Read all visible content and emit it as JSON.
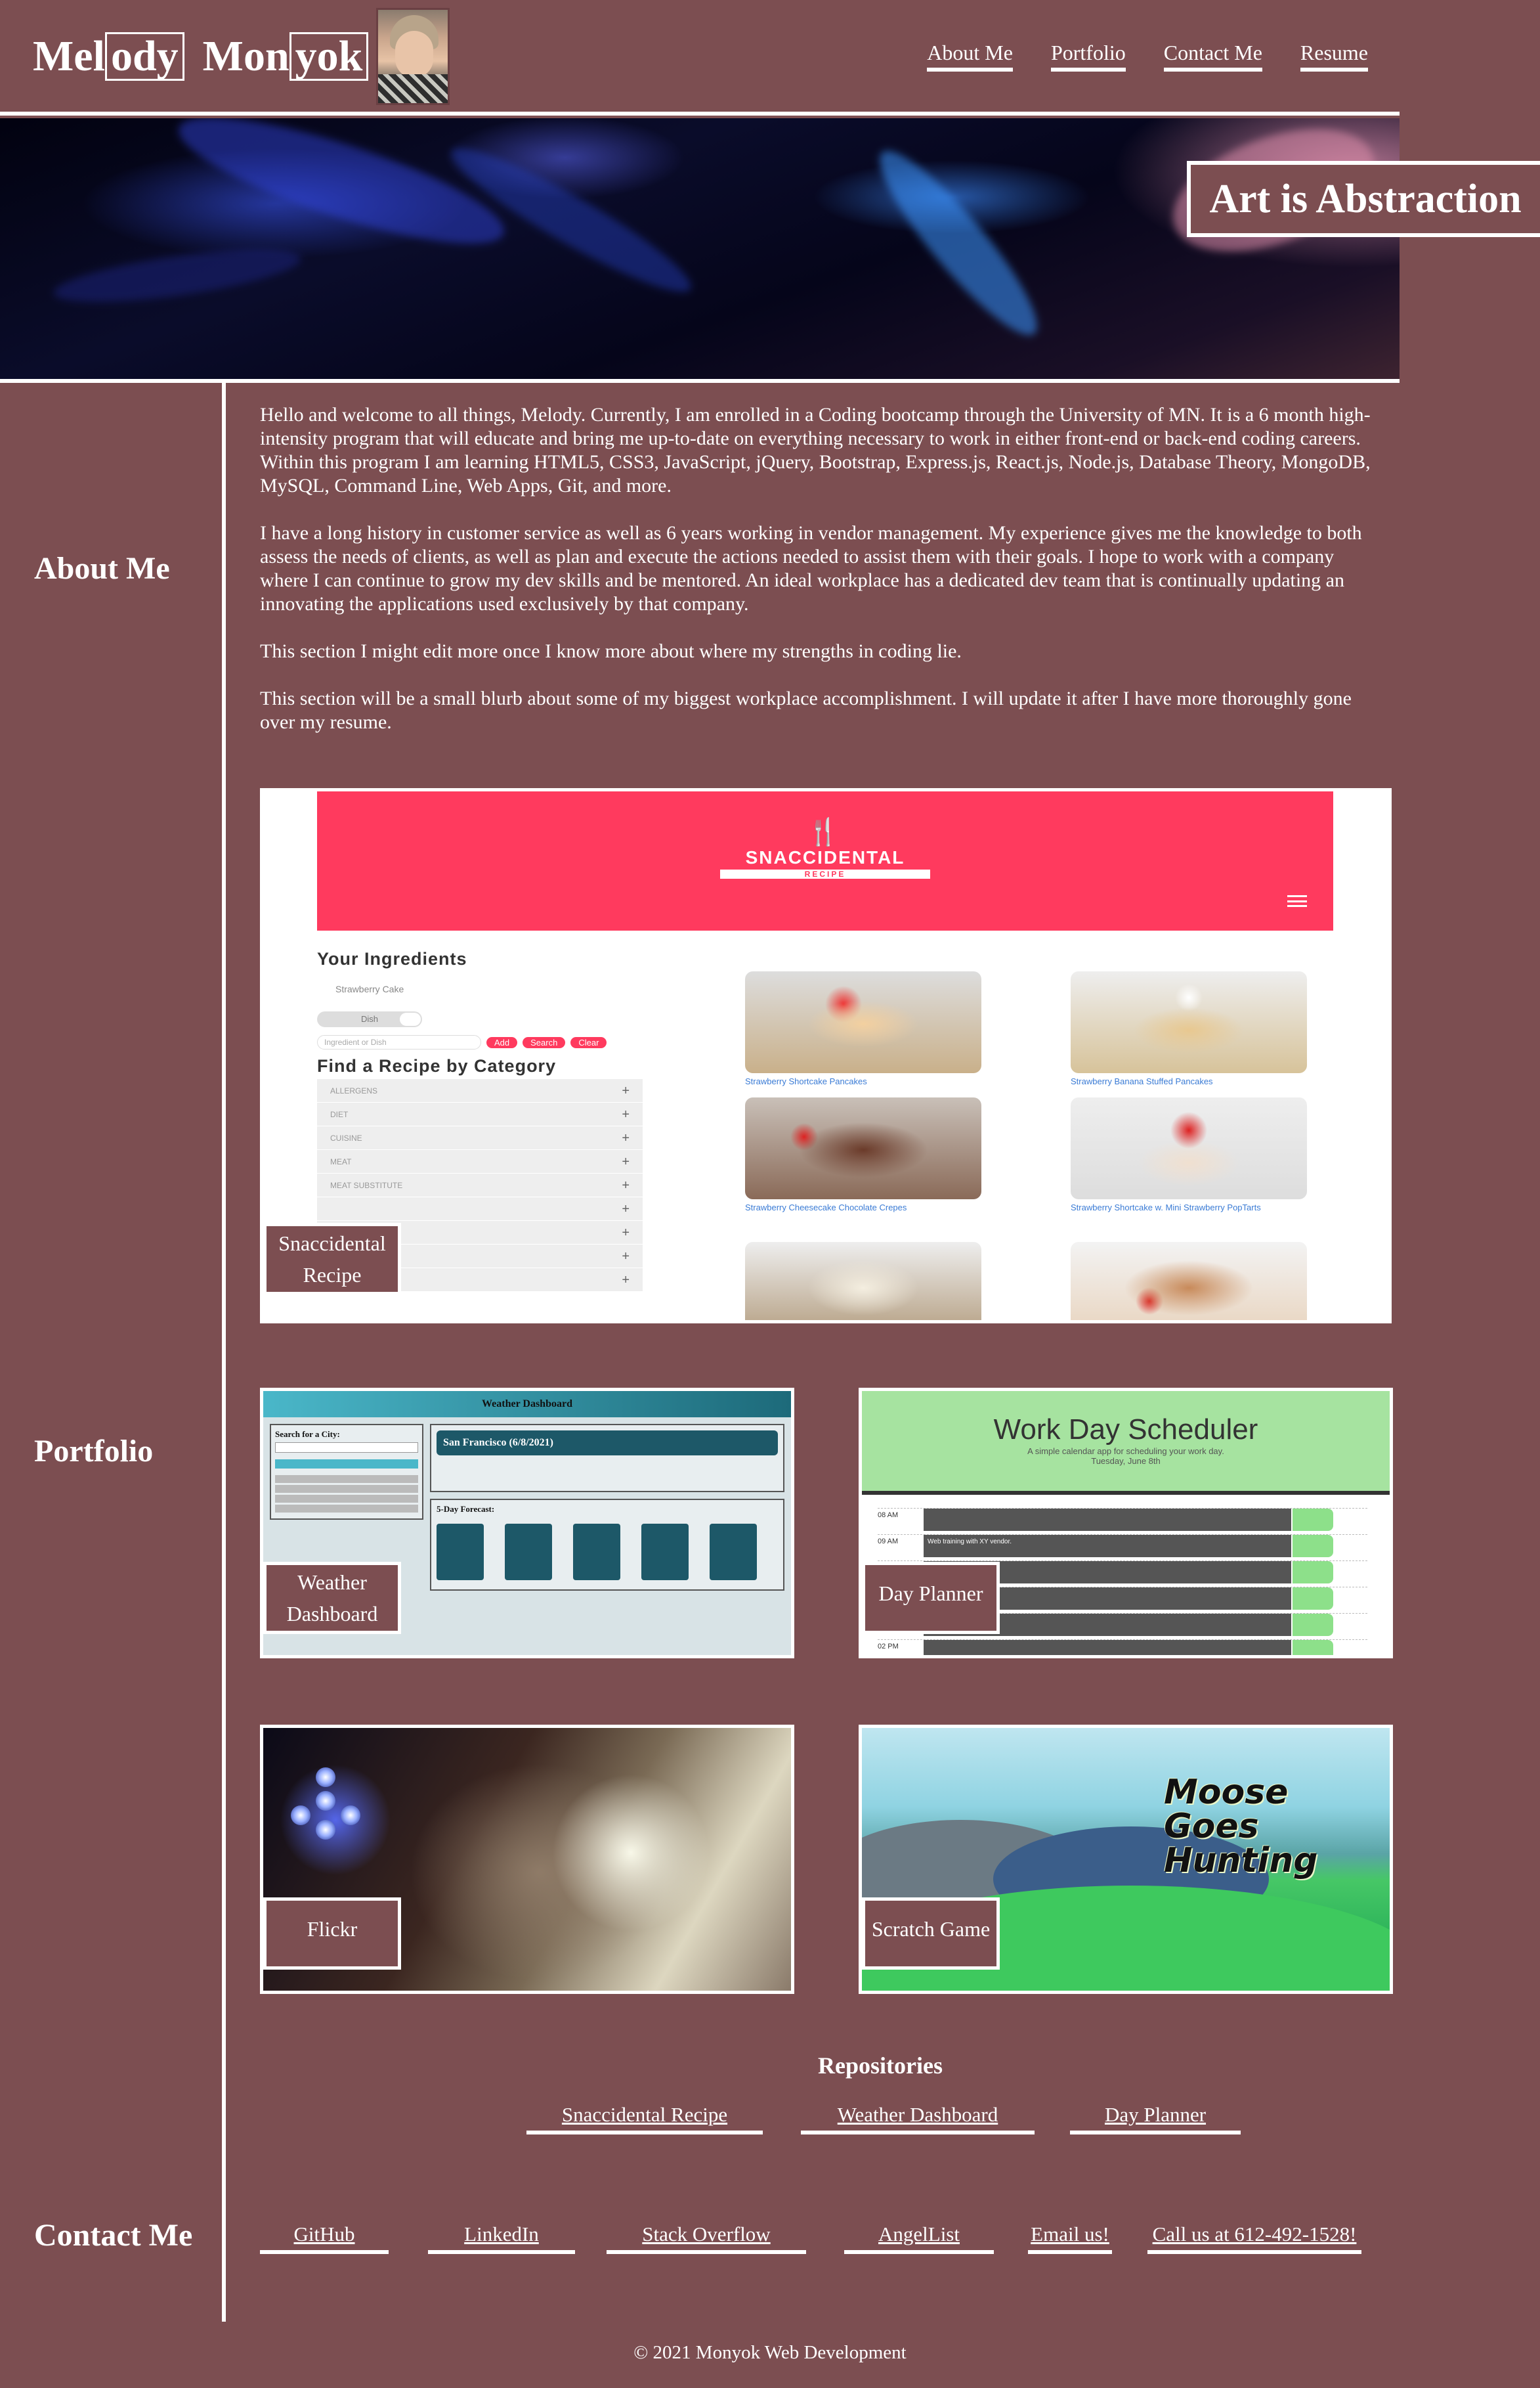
{
  "header": {
    "brand_parts": [
      "Mel",
      "ody",
      "Mon",
      "yok"
    ],
    "nav": [
      {
        "label": "About Me"
      },
      {
        "label": "Portfolio"
      },
      {
        "label": "Contact Me"
      },
      {
        "label": "Resume"
      }
    ]
  },
  "hero": {
    "title": "Art is Abstraction"
  },
  "sidebar": {
    "about": "About Me",
    "portfolio": "Portfolio",
    "contact": "Contact Me"
  },
  "about": {
    "paragraphs": [
      "Hello and welcome to all things, Melody. Currently, I am enrolled in a Coding bootcamp through the University of MN. It is a 6 month high-intensity program that will educate and bring me up-to-date on everything necessary to work in either front-end or back-end coding careers. Within this program I am learning HTML5, CSS3, JavaScript, jQuery, Bootstrap, Express.js, React.js, Node.js, Database Theory, MongoDB, MySQL, Command Line, Web Apps, Git, and more.",
      "I have a long history in customer service as well as 6 years working in vendor management. My experience gives me the knowledge to both assess the needs of clients, as well as plan and execute the actions needed to assist them with their goals. I hope to work with a company where I can continue to grow my dev skills and be mentored. An ideal workplace has a dedicated dev team that is continually updating an innovating the applications used exclusively by that company.",
      "This section I might edit more once I know more about where my strengths in coding lie.",
      "This section will be a small blurb about some of my biggest workplace accomplishment. I will update it after I have more thoroughly gone over my resume."
    ]
  },
  "portfolio": {
    "cards": [
      {
        "label_line1": "Snaccidental",
        "label_line2": "Recipe"
      },
      {
        "label_line1": "Weather",
        "label_line2": "Dashboard"
      },
      {
        "label_line1": "Day Planner",
        "label_line2": ""
      },
      {
        "label_line1": "Flickr",
        "label_line2": ""
      },
      {
        "label_line1": "Scratch Game",
        "label_line2": ""
      }
    ],
    "snaccidental": {
      "logo_name": "SNACCIDENTAL",
      "logo_sub": "RECIPE",
      "ingredients_heading": "Your Ingredients",
      "ingredient": "Strawberry Cake",
      "toggle": "Dish",
      "search_placeholder": "Ingredient or Dish",
      "buttons": [
        "Add",
        "Search",
        "Clear"
      ],
      "category_heading": "Find a Recipe by Category",
      "categories": [
        "ALLERGENS",
        "DIET",
        "CUISINE",
        "MEAT",
        "MEAT SUBSTITUTE",
        "",
        "",
        "",
        ""
      ],
      "recipes": [
        "Strawberry Shortcake Pancakes",
        "Strawberry Banana Stuffed Pancakes",
        "Strawberry Cheesecake Chocolate Crepes",
        "Strawberry Shortcake w. Mini Strawberry PopTarts"
      ]
    },
    "weather": {
      "title": "Weather Dashboard",
      "search_label": "Search for a City:",
      "city": "San Francisco (6/8/2021)",
      "forecast_label": "5-Day Forecast:"
    },
    "scheduler": {
      "title": "Work Day Scheduler",
      "subtitle": "A simple calendar app for scheduling your work day.",
      "date": "Tuesday, June 8th",
      "times": [
        "08 AM",
        "09 AM",
        "",
        "",
        "",
        "",
        "",
        "02 PM"
      ],
      "entry": "Web training with XY vendor."
    },
    "scratch": {
      "title_lines": [
        "Moose",
        "Goes",
        "Hunting"
      ]
    }
  },
  "repositories": {
    "title": "Repositories",
    "links": [
      "Snaccidental Recipe",
      "Weather Dashboard",
      "Day Planner"
    ]
  },
  "contact": {
    "links": [
      "GitHub",
      "LinkedIn",
      "Stack Overflow",
      "AngelList",
      "Email us!",
      "Call us at 612-492-1528!"
    ]
  },
  "footer": {
    "text": "© 2021 Monyok Web Development"
  },
  "colors": {
    "background": "#7c4e51",
    "text": "#ffffff",
    "accent_snaccidental": "#ff3a5e",
    "scheduler_header": "#a6e3a0"
  }
}
